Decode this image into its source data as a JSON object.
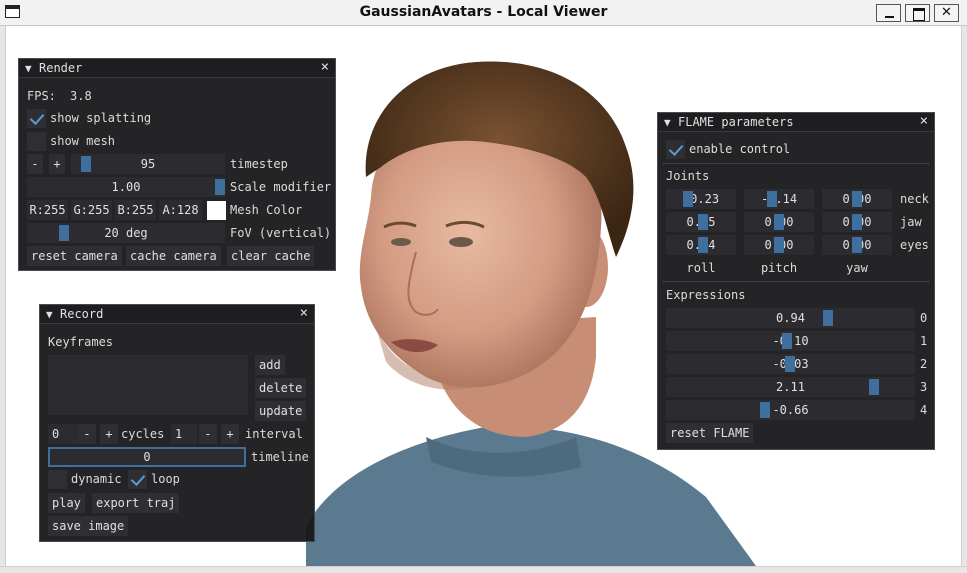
{
  "window": {
    "title": "GaussianAvatars - Local Viewer"
  },
  "render_panel": {
    "title": "Render",
    "fps_label": "FPS:",
    "fps_value": "3.8",
    "show_splatting_label": "show splatting",
    "show_splatting_checked": true,
    "show_mesh_label": "show mesh",
    "show_mesh_checked": false,
    "minus": "-",
    "plus": "+",
    "timestep_value": "95",
    "timestep_label": "timestep",
    "scale_value": "1.00",
    "scale_label": "Scale modifier",
    "color_r": "R:255",
    "color_g": "G:255",
    "color_b": "B:255",
    "color_a": "A:128",
    "mesh_color_label": "Mesh Color",
    "mesh_color": "#ffffff",
    "fov_value": "20 deg",
    "fov_label": "FoV (vertical)",
    "reset_camera": "reset camera",
    "cache_camera": "cache camera",
    "clear_cache": "clear cache"
  },
  "record_panel": {
    "title": "Record",
    "keyframes_label": "Keyframes",
    "add": "add",
    "delete": "delete",
    "update": "update",
    "keyframe_value": "0",
    "minus": "-",
    "plus": "+",
    "cycles_label": "cycles",
    "cycles_value": "1",
    "interval_label": "interval",
    "timeline_value": "0",
    "timeline_label": "timeline",
    "dynamic_label": "dynamic",
    "dynamic_checked": false,
    "loop_label": "loop",
    "loop_checked": true,
    "play": "play",
    "export_traj": "export traj",
    "save_image": "save image"
  },
  "flame_panel": {
    "title": "FLAME parameters",
    "enable_control_label": "enable control",
    "enable_control_checked": true,
    "joints_label": "Joints",
    "joint_rows": [
      {
        "label": "neck",
        "values": [
          "-0.23",
          "-0.14",
          "0.00"
        ]
      },
      {
        "label": "jaw",
        "values": [
          "0.05",
          "0.00",
          "0.00"
        ]
      },
      {
        "label": "eyes",
        "values": [
          "0.04",
          "0.00",
          "0.00"
        ]
      }
    ],
    "joint_columns": [
      "roll",
      "pitch",
      "yaw"
    ],
    "expressions_label": "Expressions",
    "expressions": [
      {
        "index": "0",
        "value": "0.94"
      },
      {
        "index": "1",
        "value": "-0.10"
      },
      {
        "index": "2",
        "value": "-0.03"
      },
      {
        "index": "3",
        "value": "2.11"
      },
      {
        "index": "4",
        "value": "-0.66"
      }
    ],
    "reset_flame": "reset FLAME"
  },
  "colors": {
    "accent": "#3f6f9e",
    "panel_bg": "#161618",
    "widget_bg": "#2c2c30"
  }
}
